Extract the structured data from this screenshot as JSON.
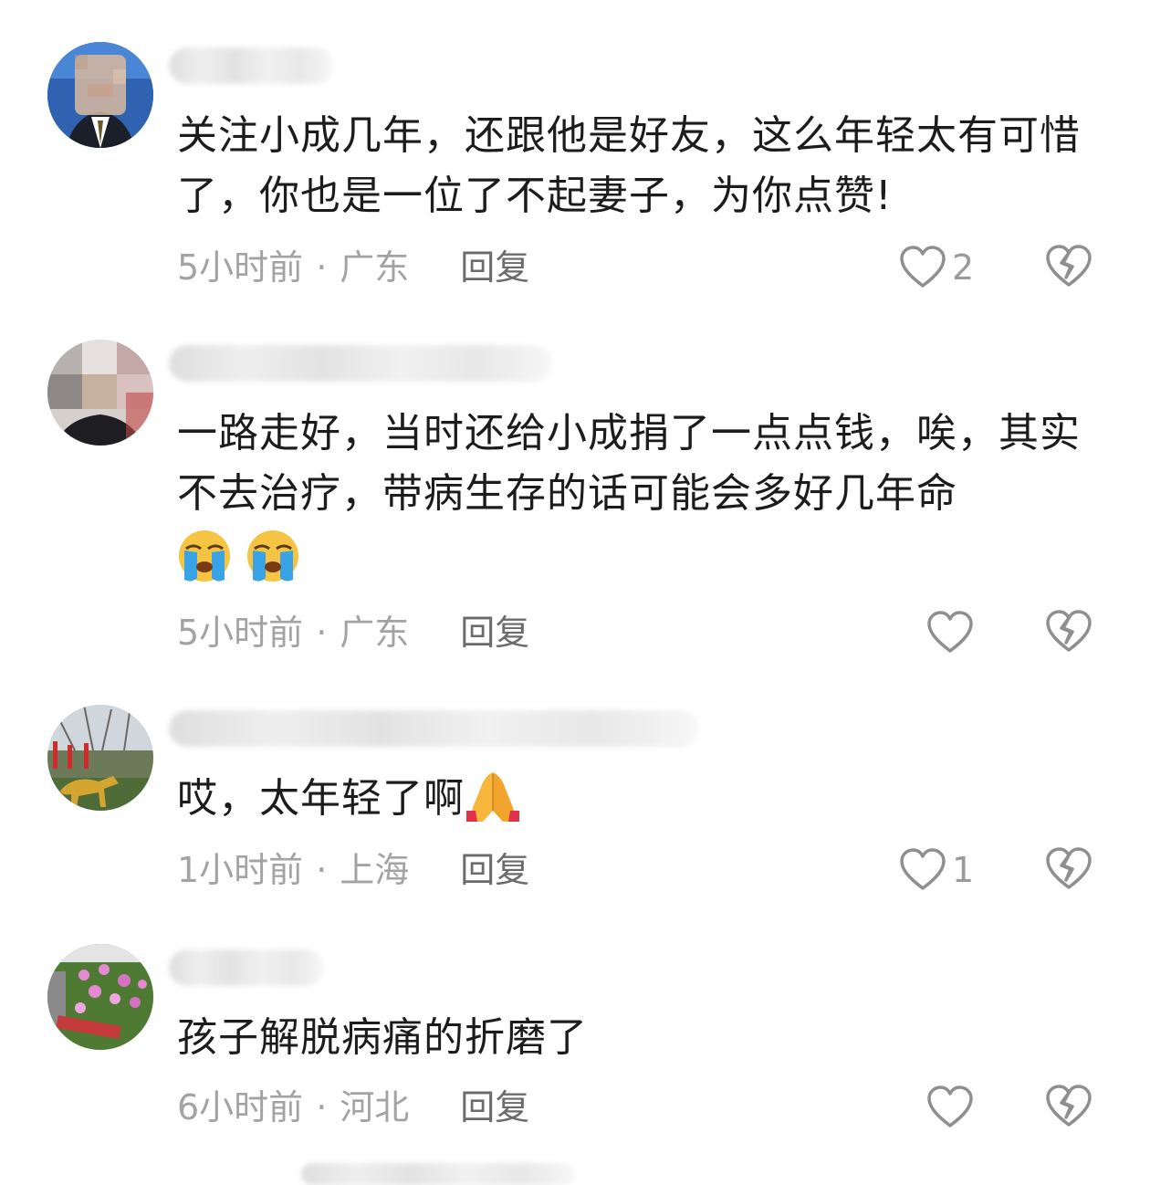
{
  "comments": [
    {
      "username": "",
      "text": "关注小成几年，还跟他是好友，这么年轻太有可惜了，你也是一位了不起妻子，为你点赞!",
      "time": "5小时前",
      "separator": "·",
      "location": "广东",
      "reply_label": "回复",
      "like_count": "2",
      "avatar_icon": "blurred-profile-photo"
    },
    {
      "username": "",
      "text": "一路走好，当时还给小成捐了一点点钱，唉，其实不去治疗，带病生存的话可能会多好几年命",
      "emojis": [
        "loudly-crying-face",
        "loudly-crying-face"
      ],
      "time": "5小时前",
      "separator": "·",
      "location": "广东",
      "reply_label": "回复",
      "like_count": "",
      "avatar_icon": "blurred-profile-photo"
    },
    {
      "username": "",
      "text": "哎，太年轻了啊",
      "emojis": [
        "folded-hands"
      ],
      "time": "1小时前",
      "separator": "·",
      "location": "上海",
      "reply_label": "回复",
      "like_count": "1",
      "avatar_icon": "golden-deer-photo"
    },
    {
      "username": "",
      "text": "孩子解脱病痛的折磨了",
      "time": "6小时前",
      "separator": "·",
      "location": "河北",
      "reply_label": "回复",
      "like_count": "",
      "avatar_icon": "flowers-photo"
    }
  ],
  "colors": {
    "meta_text": "#a3a3a3",
    "reply_text": "#6b6b6b",
    "icon_stroke": "#8f8f8f",
    "emoji_yellow": "#f6c443",
    "emoji_tear": "#3aa3e8"
  }
}
